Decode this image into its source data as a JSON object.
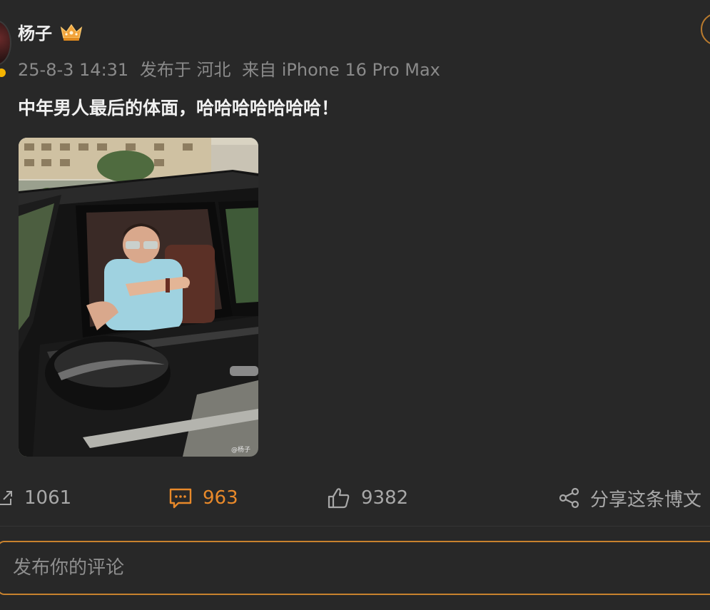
{
  "post": {
    "username": "杨子",
    "badge_icon": "crown-icon",
    "meta": {
      "datetime": "25-8-3 14:31",
      "location": "发布于 河北",
      "device": "来自 iPhone 16 Pro Max"
    },
    "text": "中年男人最后的体面，哈哈哈哈哈哈哈！",
    "image": {
      "alt": "man in a black SUV reaching out of the window",
      "watermark": "@杨子"
    }
  },
  "actions": {
    "repost": {
      "icon": "repost-icon",
      "count": "1061"
    },
    "comment": {
      "icon": "comment-icon",
      "count": "963",
      "active": true
    },
    "like": {
      "icon": "thumbs-up-icon",
      "count": "9382"
    },
    "share": {
      "icon": "share-icon",
      "label": "分享这条博文"
    }
  },
  "comment_input": {
    "placeholder": "发布你的评论",
    "value": ""
  },
  "colors": {
    "background": "#282828",
    "accent": "#e8892a",
    "muted_text": "#8a8a8a",
    "primary_text": "#f0f0f0"
  }
}
